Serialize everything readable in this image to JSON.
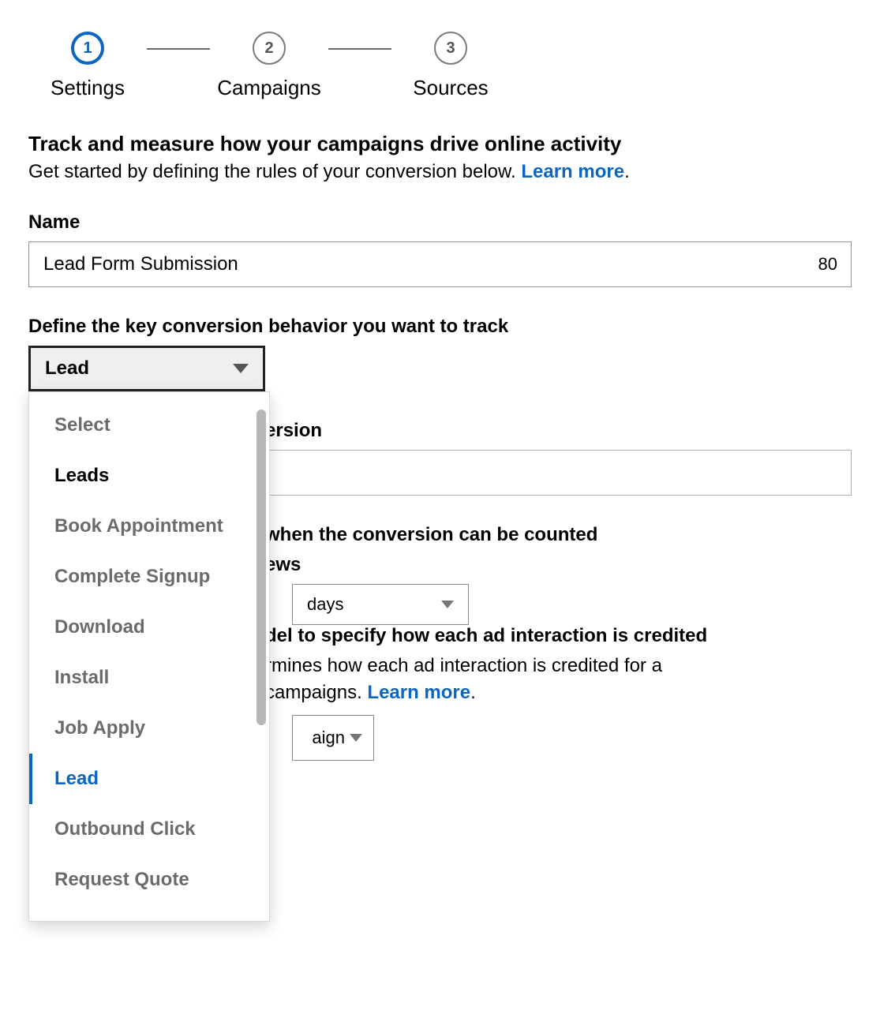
{
  "stepper": {
    "steps": [
      {
        "num": "1",
        "label": "Settings"
      },
      {
        "num": "2",
        "label": "Campaigns"
      },
      {
        "num": "3",
        "label": "Sources"
      }
    ],
    "active_index": 0
  },
  "intro": {
    "title": "Track and measure how your campaigns drive online activity",
    "subtitle_prefix": "Get started by defining the rules of your conversion below. ",
    "learn_more": "Learn more",
    "period": "."
  },
  "name_field": {
    "label": "Name",
    "value": "Lead Form Submission",
    "char_count": "80"
  },
  "behavior": {
    "label": "Define the key conversion behavior you want to track",
    "selected": "Lead",
    "options": [
      {
        "label": "Select",
        "type": "placeholder"
      },
      {
        "label": "Leads",
        "type": "group"
      },
      {
        "label": "Book Appointment",
        "type": "item"
      },
      {
        "label": "Complete Signup",
        "type": "item"
      },
      {
        "label": "Download",
        "type": "item"
      },
      {
        "label": "Install",
        "type": "item"
      },
      {
        "label": "Job Apply",
        "type": "item"
      },
      {
        "label": "Lead",
        "type": "selected"
      },
      {
        "label": "Outbound Click",
        "type": "item"
      },
      {
        "label": "Request Quote",
        "type": "item"
      }
    ]
  },
  "value_section": {
    "heading_suffix": "ersion"
  },
  "timeframe": {
    "heading_suffix": "when the conversion can be counted",
    "views_suffix": "ews",
    "days_label": "days"
  },
  "attribution": {
    "heading_suffix": "del to specify how each ad interaction is credited",
    "body_mid": "rmines how each ad interaction is credited for a",
    "body_end_prefix": " campaigns. ",
    "learn_more": "Learn more",
    "period": ".",
    "select_suffix": "aign"
  }
}
